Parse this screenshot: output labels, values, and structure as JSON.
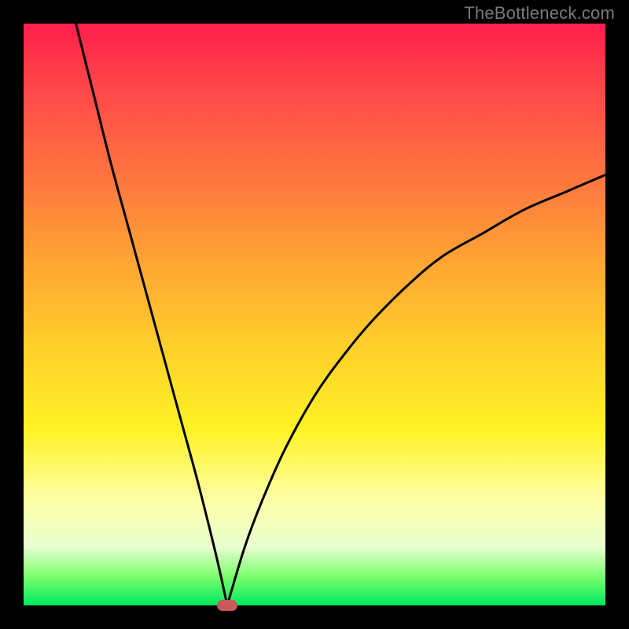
{
  "watermark": "TheBottleneck.com",
  "colors": {
    "frame": "#000000",
    "gradient_top": "#ff1f4b",
    "gradient_bottom": "#00e85e",
    "curve": "#000000",
    "marker": "#c75b5b",
    "watermark_text": "#7a7a7a"
  },
  "chart_data": {
    "type": "line",
    "title": "",
    "xlabel": "",
    "ylabel": "",
    "xlim": [
      0,
      100
    ],
    "ylim": [
      0,
      100
    ],
    "vertex_x": 35,
    "series": [
      {
        "name": "left-branch",
        "x": [
          9,
          12,
          15,
          18,
          21,
          24,
          27,
          30,
          33,
          35
        ],
        "values": [
          100,
          88,
          76,
          65,
          54,
          43,
          32,
          21,
          9,
          0
        ]
      },
      {
        "name": "right-branch",
        "x": [
          35,
          38,
          41,
          45,
          50,
          55,
          60,
          66,
          72,
          79,
          86,
          93,
          100
        ],
        "values": [
          0,
          10,
          18,
          27,
          36,
          43,
          49,
          55,
          60,
          64,
          68,
          71,
          74
        ]
      }
    ],
    "marker": {
      "x": 35,
      "y": 0
    }
  }
}
